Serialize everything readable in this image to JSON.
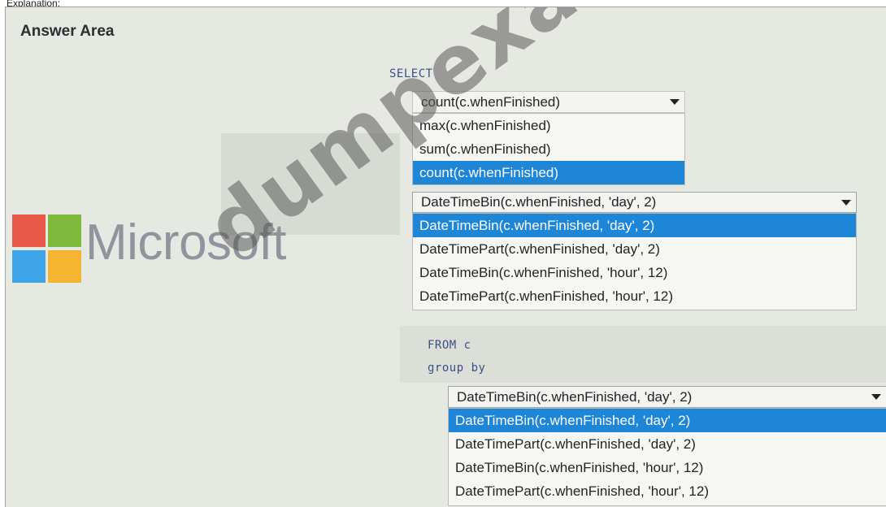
{
  "header": {
    "text": "Explanation:"
  },
  "answer_area": {
    "title": "Answer Area"
  },
  "logo": {
    "text": "Microsoft",
    "colors": [
      "#e8594a",
      "#7fba3d",
      "#3fa4e8",
      "#f5b533"
    ]
  },
  "query": {
    "select_kw": "SELECT",
    "from_kw": "FROM c",
    "group_kw": "group by"
  },
  "dropdown_agg": {
    "value": "count(c.whenFinished)",
    "options": [
      "max(c.whenFinished)",
      "sum(c.whenFinished)",
      "count(c.whenFinished)"
    ],
    "selected_index": 2
  },
  "dropdown_bin": {
    "value": "DateTimeBin(c.whenFinished, 'day', 2)",
    "options": [
      "DateTimeBin(c.whenFinished, 'day', 2)",
      "DateTimePart(c.whenFinished, 'day', 2)",
      "DateTimeBin(c.whenFinished, 'hour', 12)",
      "DateTimePart(c.whenFinished, 'hour', 12)"
    ],
    "selected_index": 0
  },
  "dropdown_group": {
    "value": "DateTimeBin(c.whenFinished, 'day', 2)",
    "options": [
      "DateTimeBin(c.whenFinished, 'day', 2)",
      "DateTimePart(c.whenFinished, 'day', 2)",
      "DateTimeBin(c.whenFinished, 'hour', 12)",
      "DateTimePart(c.whenFinished, 'hour', 12)"
    ],
    "selected_index": 0
  },
  "watermark": {
    "text": "dumpexams.com"
  },
  "colors": {
    "selection": "#1e86d6",
    "keyword": "#3a4f86"
  }
}
